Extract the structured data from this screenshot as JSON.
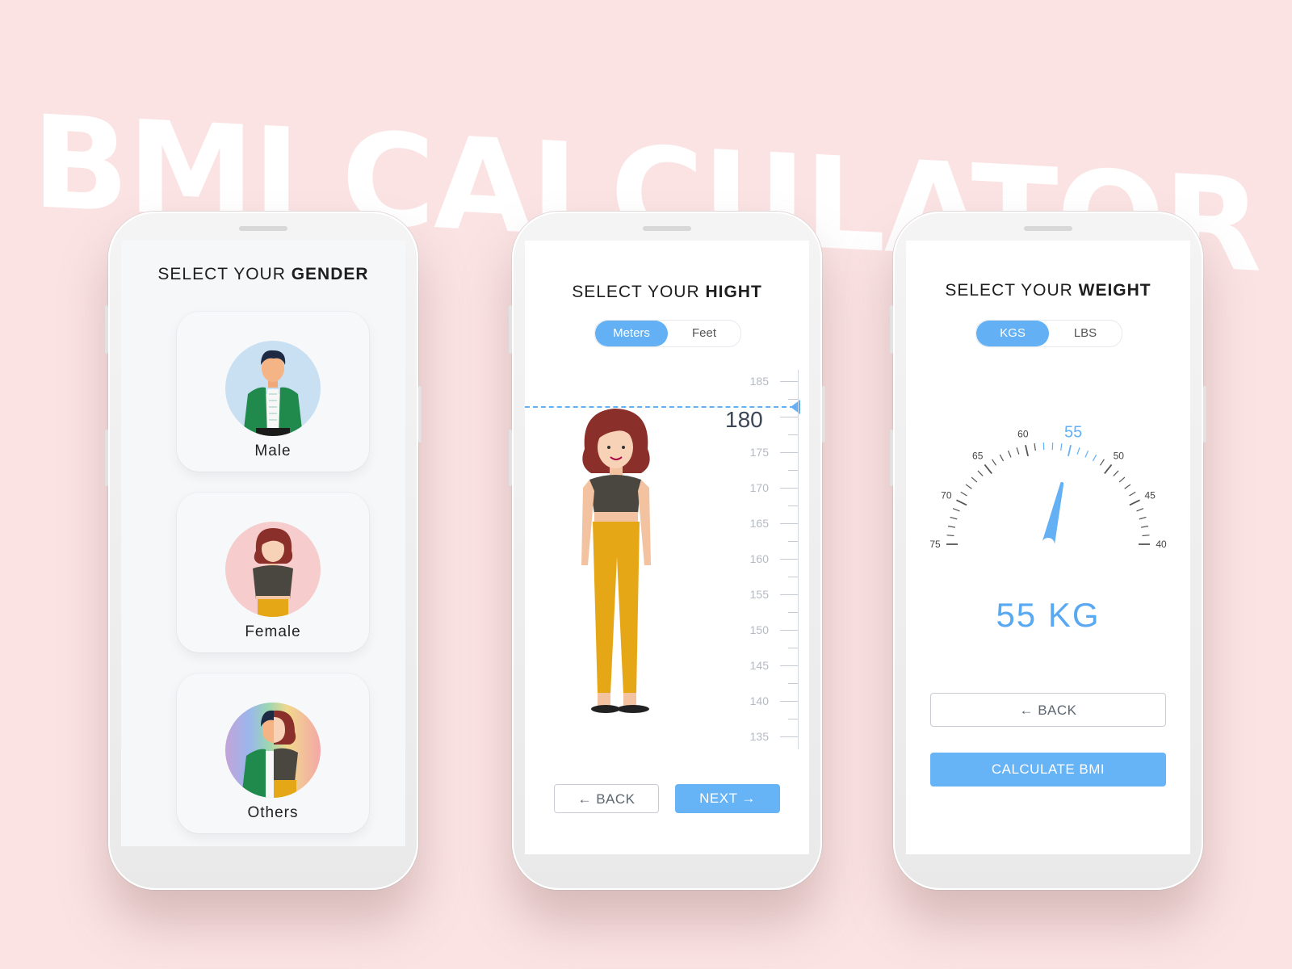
{
  "hero_title": "BMI CALCULATOR",
  "colors": {
    "background": "#fbe3e3",
    "accent": "#63b0f5",
    "hair": "#8a2f2a",
    "pants": "#e6a716",
    "shirt": "#4a4740",
    "jacket": "#1f8a4c"
  },
  "gender_screen": {
    "title_prefix": "SELECT YOUR ",
    "title_bold": "GENDER",
    "options": [
      {
        "label": "Male",
        "icon": "male-avatar-icon"
      },
      {
        "label": "Female",
        "icon": "female-avatar-icon"
      },
      {
        "label": "Others",
        "icon": "others-avatar-icon"
      }
    ]
  },
  "height_screen": {
    "title_prefix": "SELECT YOUR ",
    "title_bold": "HIGHT",
    "units": [
      "Meters",
      "Feet"
    ],
    "selected_unit": "Meters",
    "selected_value": "180",
    "ruler_labels": [
      "185",
      "175",
      "170",
      "165",
      "160",
      "155",
      "150",
      "145",
      "140",
      "135"
    ],
    "back_label": "← BACK",
    "next_label": "NEXT →"
  },
  "weight_screen": {
    "title_prefix": "SELECT YOUR ",
    "title_bold": "WEIGHT",
    "units": [
      "KGS",
      "LBS"
    ],
    "selected_unit": "KGS",
    "gauge_labels": [
      "75",
      "70",
      "65",
      "60",
      "55",
      "50",
      "45",
      "40"
    ],
    "gauge_value": 55,
    "value_text": "55 KG",
    "back_label": "← BACK",
    "calculate_label": "CALCULATE BMI"
  }
}
